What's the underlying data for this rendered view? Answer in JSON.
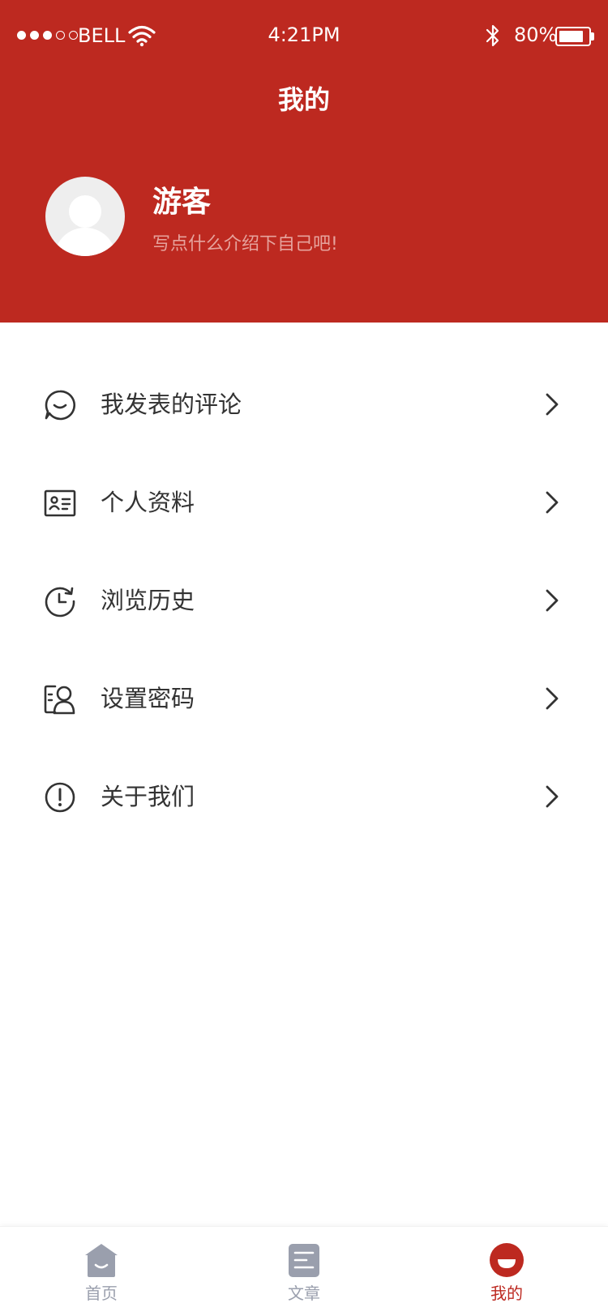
{
  "status_bar": {
    "carrier": "BELL",
    "time": "4:21PM",
    "battery": "80%",
    "battery_level": 0.8,
    "signal_bars": 3,
    "signal_total": 5
  },
  "header": {
    "title": "我的"
  },
  "profile": {
    "name": "游客",
    "bio": "写点什么介绍下自己吧!"
  },
  "menu": {
    "items": [
      {
        "label": "我发表的评论",
        "icon": "comment-icon"
      },
      {
        "label": "个人资料",
        "icon": "id-card-icon"
      },
      {
        "label": "浏览历史",
        "icon": "history-icon"
      },
      {
        "label": "设置密码",
        "icon": "user-lock-icon"
      },
      {
        "label": "关于我们",
        "icon": "info-icon"
      }
    ]
  },
  "tabbar": {
    "tabs": [
      {
        "label": "首页",
        "icon": "home-icon"
      },
      {
        "label": "文章",
        "icon": "article-icon"
      },
      {
        "label": "我的",
        "icon": "profile-icon",
        "active": true
      }
    ]
  },
  "colors": {
    "brand": "#BD2920",
    "tab_inactive": "#9A9FAD",
    "text": "#333333"
  }
}
